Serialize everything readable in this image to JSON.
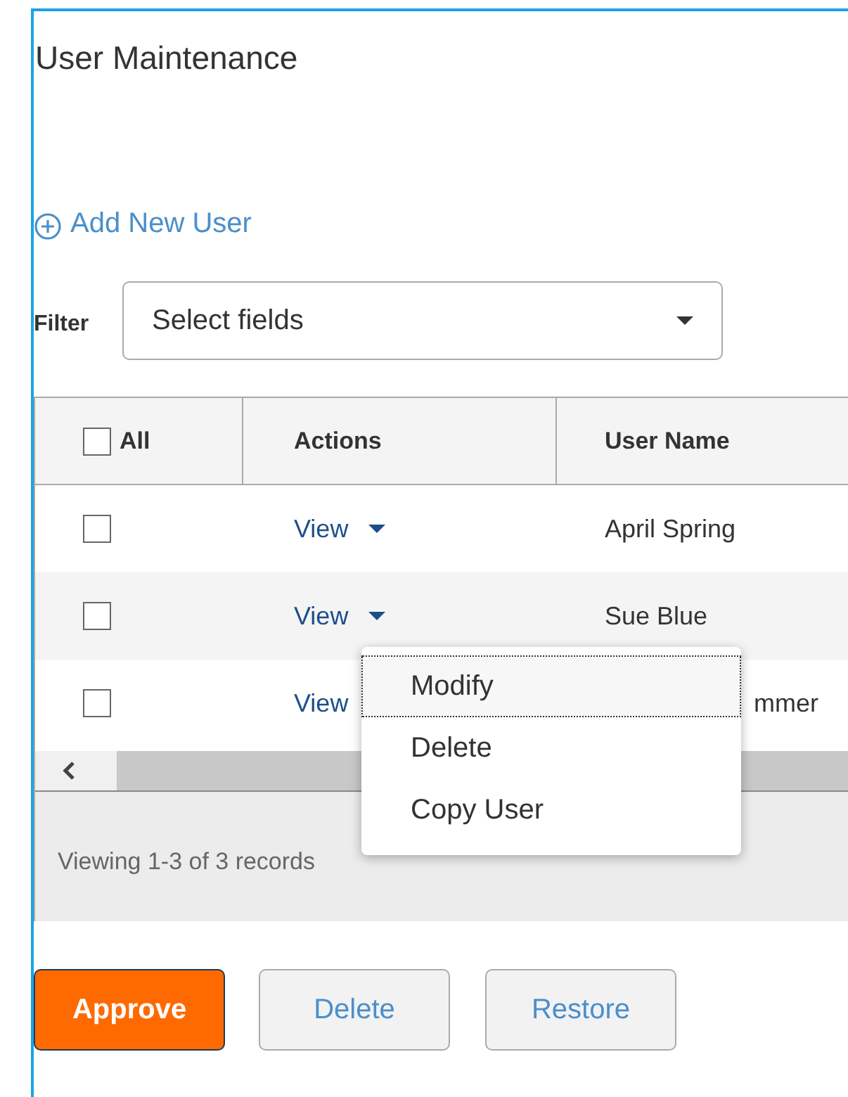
{
  "title": "User Maintenance",
  "add_link": {
    "label": "Add New User"
  },
  "filter": {
    "label": "Filter",
    "placeholder": "Select fields"
  },
  "table": {
    "select_all": {
      "label": "All",
      "checked": false
    },
    "columns": [
      "Actions",
      "User Name"
    ],
    "rows": [
      {
        "checked": false,
        "action": "View",
        "name": "April Spring",
        "covered": false
      },
      {
        "checked": false,
        "action": "View",
        "name": "Sue Blue",
        "covered": false
      },
      {
        "checked": false,
        "action": "View",
        "name": "mmer",
        "covered": true
      }
    ],
    "footer": "Viewing 1-3 of 3 records"
  },
  "menu": {
    "items": [
      {
        "label": "Modify",
        "selected": true
      },
      {
        "label": "Delete",
        "selected": false
      },
      {
        "label": "Copy User",
        "selected": false
      }
    ]
  },
  "buttons": [
    {
      "label": "Approve",
      "kind": "primary"
    },
    {
      "label": "Delete",
      "kind": "secondary"
    },
    {
      "label": "Restore",
      "kind": "secondary"
    }
  ]
}
